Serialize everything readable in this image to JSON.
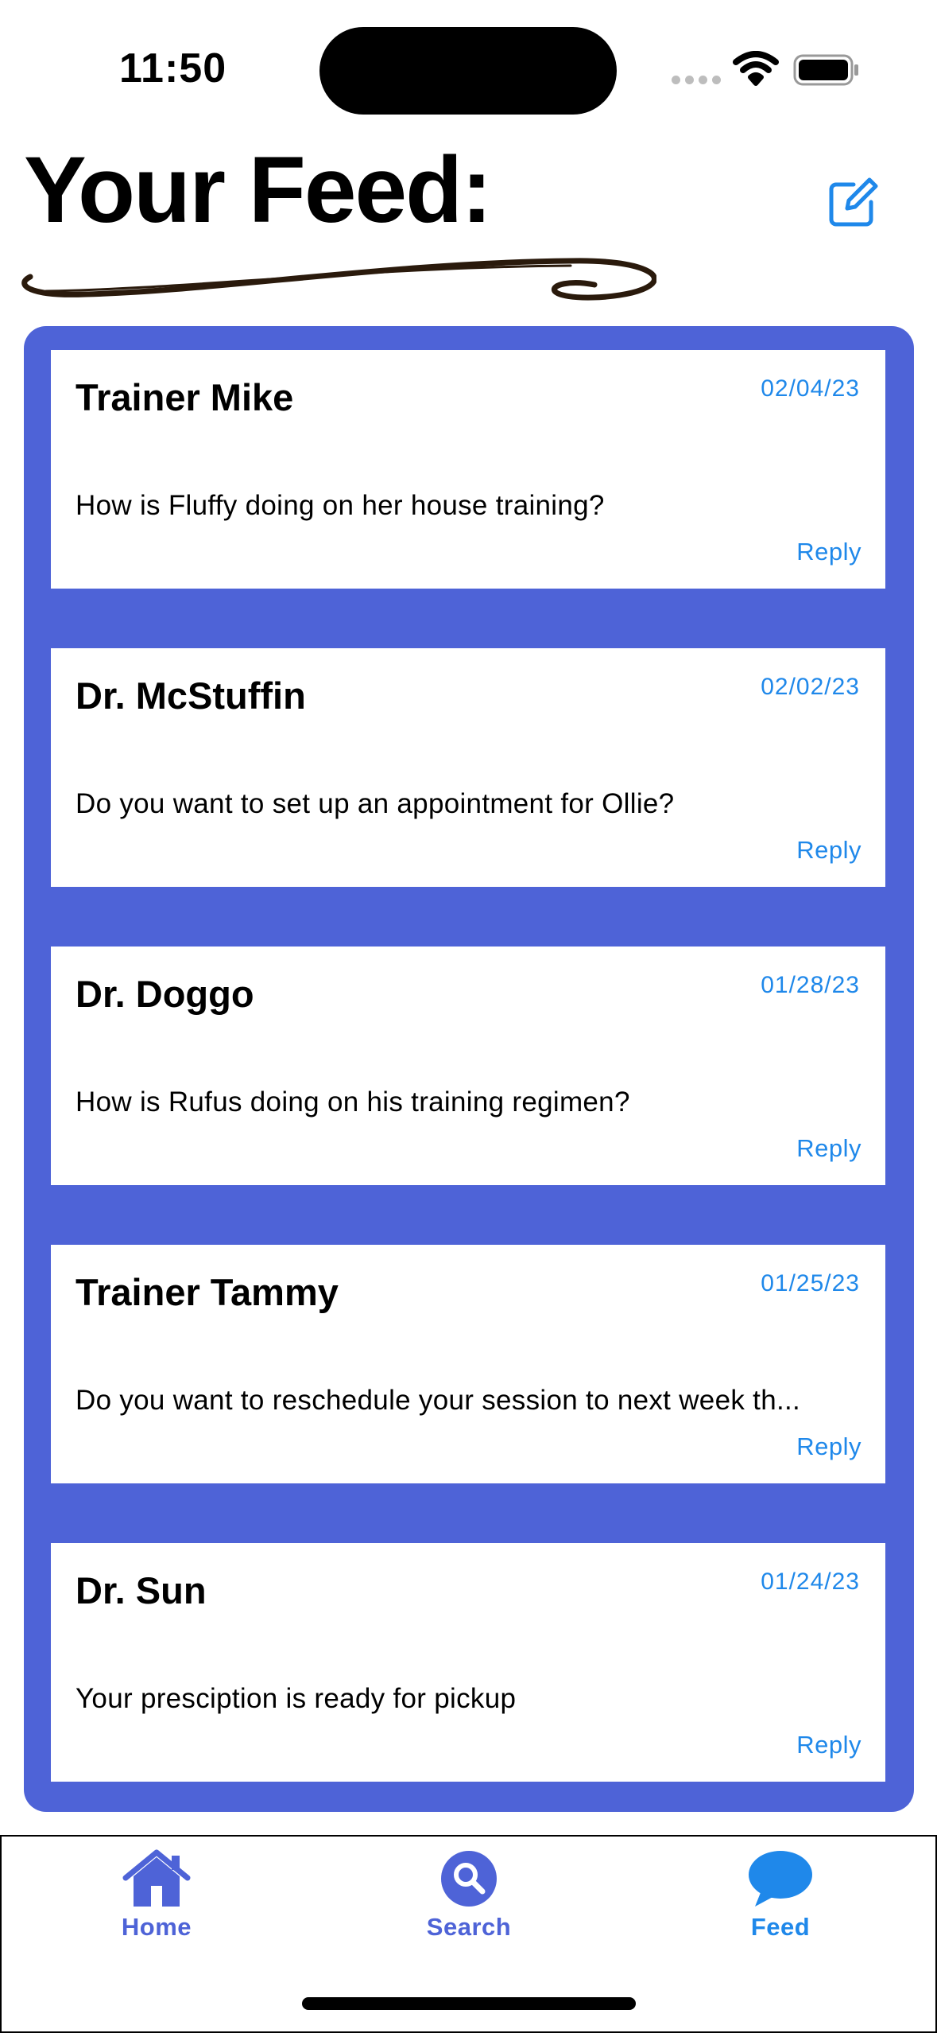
{
  "status_bar": {
    "time": "11:50"
  },
  "header": {
    "title": "Your Feed:",
    "compose_icon": "compose-icon"
  },
  "colors": {
    "accent_blue": "#4e63d7",
    "link_blue": "#1f88ea"
  },
  "feed": {
    "messages": [
      {
        "sender": "Trainer Mike",
        "date": "02/04/23",
        "message": "How is Fluffy doing on her house training?",
        "reply_label": "Reply"
      },
      {
        "sender": "Dr. McStuffin",
        "date": "02/02/23",
        "message": "Do you want to set up an appointment for Ollie?",
        "reply_label": "Reply"
      },
      {
        "sender": "Dr. Doggo",
        "date": "01/28/23",
        "message": "How is Rufus doing on his training regimen?",
        "reply_label": "Reply"
      },
      {
        "sender": "Trainer Tammy",
        "date": "01/25/23",
        "message": "Do you want to reschedule your session to next week th...",
        "reply_label": "Reply"
      },
      {
        "sender": "Dr. Sun",
        "date": "01/24/23",
        "message": "Your presciption is ready for pickup",
        "reply_label": "Reply"
      }
    ]
  },
  "tab_bar": {
    "items": [
      {
        "label": "Home",
        "icon": "house-icon"
      },
      {
        "label": "Search",
        "icon": "search-icon"
      },
      {
        "label": "Feed",
        "icon": "chat-bubble-icon"
      }
    ]
  }
}
